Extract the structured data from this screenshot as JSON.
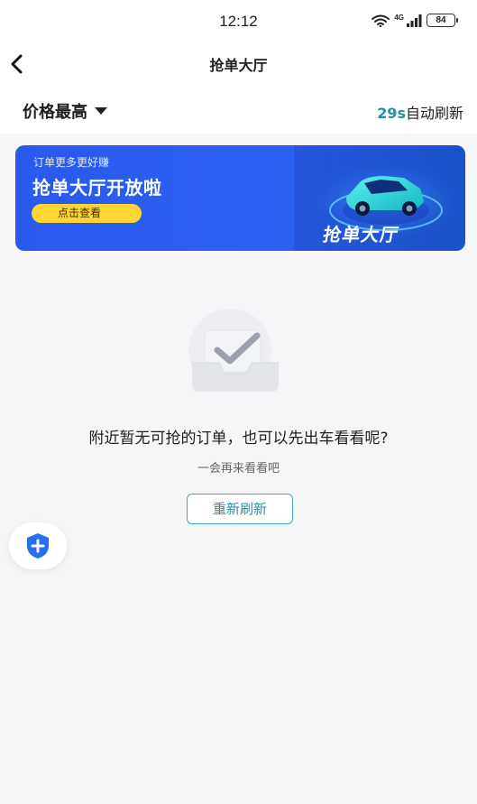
{
  "status_bar": {
    "time": "12:12",
    "signal_label": "4G",
    "battery_level": "84"
  },
  "nav": {
    "title": "抢单大厅",
    "back_icon": "chevron-left-icon"
  },
  "filter": {
    "sort_label": "价格最高",
    "dropdown_icon": "caret-down-icon",
    "refresh_seconds": "29s",
    "refresh_text": "自动刷新"
  },
  "banner": {
    "subtitle": "订单更多更好赚",
    "title": "抢单大厅开放啦",
    "cta_label": "点击查看",
    "art_label": "抢单大厅",
    "colors": {
      "background": "#2b60f2",
      "cta": "#ffd633",
      "car": "#22d3d8"
    }
  },
  "empty_state": {
    "title": "附近暂无可抢的订单，也可以先出车看看呢?",
    "subtitle": "一会再来看看吧",
    "refresh_button_label": "重新刷新"
  },
  "fab": {
    "icon": "shield-plus-icon",
    "color": "#2a6ef0"
  },
  "colors": {
    "accent": "#2a8fa3",
    "page_background": "#f5f6f8"
  }
}
